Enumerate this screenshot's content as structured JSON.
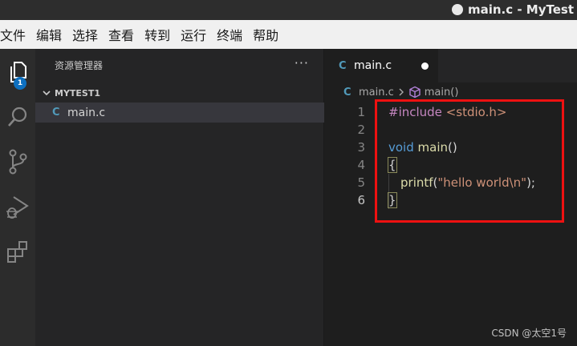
{
  "window": {
    "title": "main.c - MyTest"
  },
  "menu": {
    "items": [
      "文件",
      "编辑",
      "选择",
      "查看",
      "转到",
      "运行",
      "终端",
      "帮助"
    ]
  },
  "activity_bar": {
    "items": [
      {
        "icon": "files-icon",
        "badge": "1"
      },
      {
        "icon": "search-icon"
      },
      {
        "icon": "source-control-icon"
      },
      {
        "icon": "run-debug-icon"
      },
      {
        "icon": "extensions-icon"
      }
    ]
  },
  "sidebar": {
    "header": "资源管理器",
    "more": "···",
    "folder": "MYTEST1",
    "files": [
      {
        "icon": "C",
        "name": "main.c"
      }
    ]
  },
  "editor": {
    "tab": {
      "icon": "C",
      "label": "main.c"
    },
    "breadcrumb": {
      "icon": "C",
      "file": "main.c",
      "symbol": "main()"
    },
    "lines": [
      {
        "num": "1",
        "text": "#include <stdio.h>"
      },
      {
        "num": "2",
        "text": ""
      },
      {
        "num": "3",
        "text": "void main()"
      },
      {
        "num": "4",
        "text": "{"
      },
      {
        "num": "5",
        "text": "printf(\"hello world\\n\");"
      },
      {
        "num": "6",
        "text": "}"
      }
    ],
    "active_line": "6"
  },
  "watermark": "CSDN @太空1号",
  "colors": {
    "highlight_box": "#ee1111",
    "badge": "#0e70c0"
  }
}
